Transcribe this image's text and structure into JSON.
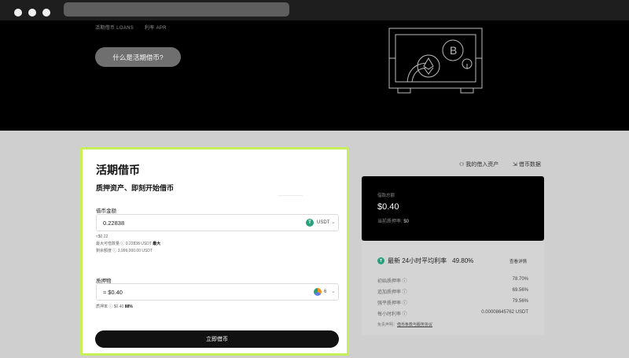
{
  "hero": {
    "tiny_left": "活期借币 LOANS",
    "tiny_right": "利率 APR",
    "what_button": "什么是活期借币?"
  },
  "form": {
    "title": "活期借币",
    "subtitle": "质押资产、即刻开始借币",
    "borrow_label": "借币金额",
    "borrow_value": "0.22838",
    "borrow_unit": "USDT",
    "borrow_usd": "≈$0.22",
    "max_text": "最大可借数量 ⓘ 0.22838 USDT",
    "max_btn": "最大",
    "quota_text": "剩余额度 ⓘ 3,999,000.00 USDT",
    "collateral_label": "质押物",
    "collateral_value": "≈ $0.40",
    "collateral_unit": "6",
    "ltv_text": "质押率 ⓘ $0.40",
    "ltv_val": "88%",
    "submit_label": "立即借币"
  },
  "links": {
    "my_assets": "我的借入资产",
    "borrow_data": "借币数据"
  },
  "summary": {
    "label": "借款总额",
    "value": "$0.40",
    "ltv_label": "当前质押率:",
    "ltv_value": "$0"
  },
  "detail": {
    "coin_icon": "T",
    "head_text": "最新 24小时平均利率",
    "head_value": "49.80%",
    "action": "查看详情",
    "rows": [
      {
        "label": "初始质押率 ⓘ",
        "value": "78.70%"
      },
      {
        "label": "追加质押率 ⓘ",
        "value": "69.56%"
      },
      {
        "label": "强平质押率 ⓘ",
        "value": "79.56%"
      },
      {
        "label": "每小时利率 ⓘ",
        "value": "0.00008645762 USDT"
      }
    ],
    "note_prefix": "免责声明：",
    "note_link": "借币条款与服务协议"
  },
  "colors": {
    "highlight": "#c6ef5a",
    "usdt": "#26a17b",
    "dark": "#000000"
  }
}
